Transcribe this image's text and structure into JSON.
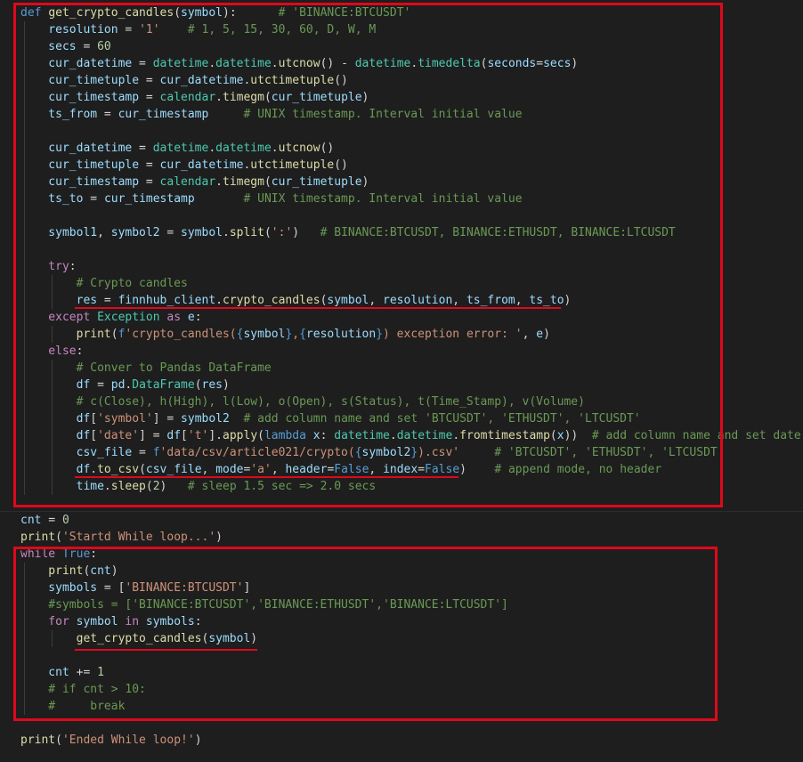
{
  "cell1": {
    "lines": [
      [
        [
          "kw",
          "def "
        ],
        [
          "fn",
          "get_crypto_candles"
        ],
        [
          "pl",
          "("
        ],
        [
          "var",
          "symbol"
        ],
        [
          "pl",
          "):      "
        ],
        [
          "cm",
          "# 'BINANCE:BTCUSDT'"
        ]
      ],
      [
        [
          "var",
          "    resolution"
        ],
        [
          "pl",
          " = "
        ],
        [
          "str",
          "'1'"
        ],
        [
          "pl",
          "    "
        ],
        [
          "cm",
          "# 1, 5, 15, 30, 60, D, W, M"
        ]
      ],
      [
        [
          "var",
          "    secs"
        ],
        [
          "pl",
          " = "
        ],
        [
          "num",
          "60"
        ]
      ],
      [
        [
          "var",
          "    cur_datetime"
        ],
        [
          "pl",
          " = "
        ],
        [
          "cls",
          "datetime"
        ],
        [
          "pl",
          "."
        ],
        [
          "cls",
          "datetime"
        ],
        [
          "pl",
          "."
        ],
        [
          "fn",
          "utcnow"
        ],
        [
          "pl",
          "() - "
        ],
        [
          "cls",
          "datetime"
        ],
        [
          "pl",
          "."
        ],
        [
          "cls",
          "timedelta"
        ],
        [
          "pl",
          "("
        ],
        [
          "var",
          "seconds"
        ],
        [
          "pl",
          "="
        ],
        [
          "var",
          "secs"
        ],
        [
          "pl",
          ")"
        ]
      ],
      [
        [
          "var",
          "    cur_timetuple"
        ],
        [
          "pl",
          " = "
        ],
        [
          "var",
          "cur_datetime"
        ],
        [
          "pl",
          "."
        ],
        [
          "fn",
          "utctimetuple"
        ],
        [
          "pl",
          "()"
        ]
      ],
      [
        [
          "var",
          "    cur_timestamp"
        ],
        [
          "pl",
          " = "
        ],
        [
          "cls",
          "calendar"
        ],
        [
          "pl",
          "."
        ],
        [
          "fn",
          "timegm"
        ],
        [
          "pl",
          "("
        ],
        [
          "var",
          "cur_timetuple"
        ],
        [
          "pl",
          ")"
        ]
      ],
      [
        [
          "var",
          "    ts_from"
        ],
        [
          "pl",
          " = "
        ],
        [
          "var",
          "cur_timestamp"
        ],
        [
          "pl",
          "     "
        ],
        [
          "cm",
          "# UNIX timestamp. Interval initial value"
        ]
      ],
      [],
      [
        [
          "var",
          "    cur_datetime"
        ],
        [
          "pl",
          " = "
        ],
        [
          "cls",
          "datetime"
        ],
        [
          "pl",
          "."
        ],
        [
          "cls",
          "datetime"
        ],
        [
          "pl",
          "."
        ],
        [
          "fn",
          "utcnow"
        ],
        [
          "pl",
          "()"
        ]
      ],
      [
        [
          "var",
          "    cur_timetuple"
        ],
        [
          "pl",
          " = "
        ],
        [
          "var",
          "cur_datetime"
        ],
        [
          "pl",
          "."
        ],
        [
          "fn",
          "utctimetuple"
        ],
        [
          "pl",
          "()"
        ]
      ],
      [
        [
          "var",
          "    cur_timestamp"
        ],
        [
          "pl",
          " = "
        ],
        [
          "cls",
          "calendar"
        ],
        [
          "pl",
          "."
        ],
        [
          "fn",
          "timegm"
        ],
        [
          "pl",
          "("
        ],
        [
          "var",
          "cur_timetuple"
        ],
        [
          "pl",
          ")"
        ]
      ],
      [
        [
          "var",
          "    ts_to"
        ],
        [
          "pl",
          " = "
        ],
        [
          "var",
          "cur_timestamp"
        ],
        [
          "pl",
          "       "
        ],
        [
          "cm",
          "# UNIX timestamp. Interval initial value"
        ]
      ],
      [],
      [
        [
          "var",
          "    symbol1"
        ],
        [
          "pl",
          ", "
        ],
        [
          "var",
          "symbol2"
        ],
        [
          "pl",
          " = "
        ],
        [
          "var",
          "symbol"
        ],
        [
          "pl",
          "."
        ],
        [
          "fn",
          "split"
        ],
        [
          "pl",
          "("
        ],
        [
          "str",
          "':'"
        ],
        [
          "pl",
          ")   "
        ],
        [
          "cm",
          "# BINANCE:BTCUSDT, BINANCE:ETHUSDT, BINANCE:LTCUSDT"
        ]
      ],
      [],
      [
        [
          "kw2",
          "    try"
        ],
        [
          "pl",
          ":"
        ]
      ],
      [
        [
          "cm",
          "        # Crypto candles"
        ]
      ],
      [
        [
          "var",
          "        res"
        ],
        [
          "pl",
          " = "
        ],
        [
          "var",
          "finnhub_client"
        ],
        [
          "pl",
          "."
        ],
        [
          "fn",
          "crypto_candles"
        ],
        [
          "pl",
          "("
        ],
        [
          "var",
          "symbol"
        ],
        [
          "pl",
          ", "
        ],
        [
          "var",
          "resolution"
        ],
        [
          "pl",
          ", "
        ],
        [
          "var",
          "ts_from"
        ],
        [
          "pl",
          ", "
        ],
        [
          "var",
          "ts_to"
        ],
        [
          "pl",
          ")"
        ]
      ],
      [
        [
          "kw2",
          "    except "
        ],
        [
          "cls",
          "Exception"
        ],
        [
          "kw2",
          " as "
        ],
        [
          "var",
          "e"
        ],
        [
          "pl",
          ":"
        ]
      ],
      [
        [
          "fn",
          "        print"
        ],
        [
          "pl",
          "("
        ],
        [
          "kw",
          "f"
        ],
        [
          "str",
          "'crypto_candles("
        ],
        [
          "kw",
          "{"
        ],
        [
          "var",
          "symbol"
        ],
        [
          "kw",
          "}"
        ],
        [
          "str",
          ","
        ],
        [
          "kw",
          "{"
        ],
        [
          "var",
          "resolution"
        ],
        [
          "kw",
          "}"
        ],
        [
          "str",
          ") exception error: '"
        ],
        [
          "pl",
          ", "
        ],
        [
          "var",
          "e"
        ],
        [
          "pl",
          ")"
        ]
      ],
      [
        [
          "kw2",
          "    else"
        ],
        [
          "pl",
          ":"
        ]
      ],
      [
        [
          "cm",
          "        # Conver to Pandas DataFrame"
        ]
      ],
      [
        [
          "var",
          "        df"
        ],
        [
          "pl",
          " = "
        ],
        [
          "var",
          "pd"
        ],
        [
          "pl",
          "."
        ],
        [
          "cls",
          "DataFrame"
        ],
        [
          "pl",
          "("
        ],
        [
          "var",
          "res"
        ],
        [
          "pl",
          ")"
        ]
      ],
      [
        [
          "cm",
          "        # c(Close), h(High), l(Low), o(Open), s(Status), t(Time_Stamp), v(Volume)"
        ]
      ],
      [
        [
          "var",
          "        df"
        ],
        [
          "pl",
          "["
        ],
        [
          "str",
          "'symbol'"
        ],
        [
          "pl",
          "] = "
        ],
        [
          "var",
          "symbol2"
        ],
        [
          "pl",
          "  "
        ],
        [
          "cm",
          "# add column name and set 'BTCUSDT', 'ETHUSDT', 'LTCUSDT'"
        ]
      ],
      [
        [
          "var",
          "        df"
        ],
        [
          "pl",
          "["
        ],
        [
          "str",
          "'date'"
        ],
        [
          "pl",
          "] = "
        ],
        [
          "var",
          "df"
        ],
        [
          "pl",
          "["
        ],
        [
          "str",
          "'t'"
        ],
        [
          "pl",
          "]."
        ],
        [
          "fn",
          "apply"
        ],
        [
          "pl",
          "("
        ],
        [
          "kw",
          "lambda "
        ],
        [
          "var",
          "x"
        ],
        [
          "pl",
          ": "
        ],
        [
          "cls",
          "datetime"
        ],
        [
          "pl",
          "."
        ],
        [
          "cls",
          "datetime"
        ],
        [
          "pl",
          "."
        ],
        [
          "fn",
          "fromtimestamp"
        ],
        [
          "pl",
          "("
        ],
        [
          "var",
          "x"
        ],
        [
          "pl",
          "))  "
        ],
        [
          "cm",
          "# add column name and set date"
        ]
      ],
      [
        [
          "var",
          "        csv_file"
        ],
        [
          "pl",
          " = "
        ],
        [
          "kw",
          "f"
        ],
        [
          "str",
          "'data/csv/article021/crypto("
        ],
        [
          "kw",
          "{"
        ],
        [
          "var",
          "symbol2"
        ],
        [
          "kw",
          "}"
        ],
        [
          "str",
          ").csv'"
        ],
        [
          "pl",
          "     "
        ],
        [
          "cm",
          "# 'BTCUSDT', 'ETHUSDT', 'LTCUSDT'"
        ]
      ],
      [
        [
          "var",
          "        df"
        ],
        [
          "pl",
          "."
        ],
        [
          "fn",
          "to_csv"
        ],
        [
          "pl",
          "("
        ],
        [
          "var",
          "csv_file"
        ],
        [
          "pl",
          ", "
        ],
        [
          "var",
          "mode"
        ],
        [
          "pl",
          "="
        ],
        [
          "str",
          "'a'"
        ],
        [
          "pl",
          ", "
        ],
        [
          "var",
          "header"
        ],
        [
          "pl",
          "="
        ],
        [
          "bool",
          "False"
        ],
        [
          "pl",
          ", "
        ],
        [
          "var",
          "index"
        ],
        [
          "pl",
          "="
        ],
        [
          "bool",
          "False"
        ],
        [
          "pl",
          ")    "
        ],
        [
          "cm",
          "# append mode, no header"
        ]
      ],
      [
        [
          "var",
          "        time"
        ],
        [
          "pl",
          "."
        ],
        [
          "fn",
          "sleep"
        ],
        [
          "pl",
          "("
        ],
        [
          "num",
          "2"
        ],
        [
          "pl",
          ")   "
        ],
        [
          "cm",
          "# sleep 1.5 sec => 2.0 secs"
        ]
      ]
    ]
  },
  "cell2": {
    "lines": [
      [
        [
          "var",
          "cnt"
        ],
        [
          "pl",
          " = "
        ],
        [
          "num",
          "0"
        ]
      ],
      [
        [
          "fn",
          "print"
        ],
        [
          "pl",
          "("
        ],
        [
          "str",
          "'Startd While loop...'"
        ],
        [
          "pl",
          ")"
        ]
      ],
      [
        [
          "kw2",
          "while "
        ],
        [
          "bool",
          "True"
        ],
        [
          "pl",
          ":"
        ]
      ],
      [
        [
          "fn",
          "    print"
        ],
        [
          "pl",
          "("
        ],
        [
          "var",
          "cnt"
        ],
        [
          "pl",
          ")"
        ]
      ],
      [
        [
          "var",
          "    symbols"
        ],
        [
          "pl",
          " = ["
        ],
        [
          "str",
          "'BINANCE:BTCUSDT'"
        ],
        [
          "pl",
          "]"
        ]
      ],
      [
        [
          "cm",
          "    #symbols = ['BINANCE:BTCUSDT','BINANCE:ETHUSDT','BINANCE:LTCUSDT']"
        ]
      ],
      [
        [
          "kw2",
          "    for "
        ],
        [
          "var",
          "symbol"
        ],
        [
          "kw2",
          " in "
        ],
        [
          "var",
          "symbols"
        ],
        [
          "pl",
          ":"
        ]
      ],
      [
        [
          "fn",
          "        get_crypto_candles"
        ],
        [
          "pl",
          "("
        ],
        [
          "var",
          "symbol"
        ],
        [
          "pl",
          ")"
        ]
      ],
      [],
      [
        [
          "var",
          "    cnt"
        ],
        [
          "pl",
          " += "
        ],
        [
          "num",
          "1"
        ]
      ],
      [
        [
          "cm",
          "    # if cnt > 10:"
        ]
      ],
      [
        [
          "cm",
          "    #     break"
        ]
      ],
      [],
      [
        [
          "fn",
          "print"
        ],
        [
          "pl",
          "("
        ],
        [
          "str",
          "'Ended While loop!'"
        ],
        [
          "pl",
          ")"
        ]
      ]
    ]
  }
}
